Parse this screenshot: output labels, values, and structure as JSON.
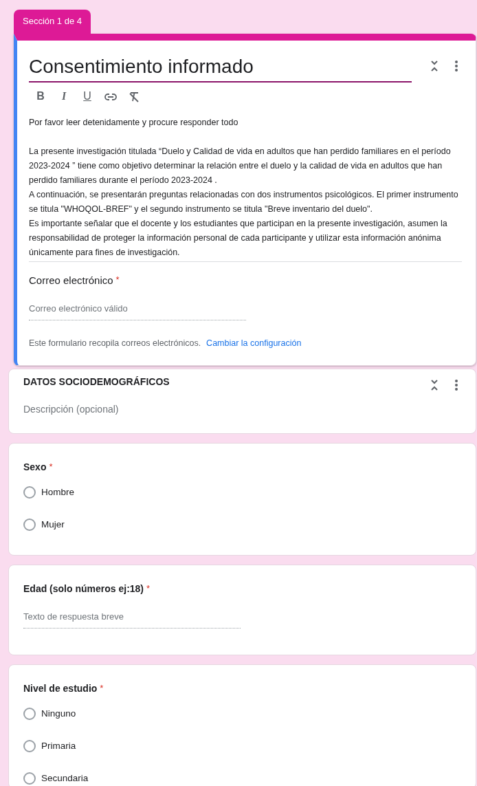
{
  "section_tab": "Sección 1 de 4",
  "header": {
    "title": "Consentimiento informado",
    "format_buttons": [
      {
        "kind": "bold",
        "label": "B"
      },
      {
        "kind": "italic",
        "label": "I"
      },
      {
        "kind": "underline",
        "label": "U"
      },
      {
        "kind": "link"
      },
      {
        "kind": "clear"
      }
    ],
    "description_intro": "Por favor leer detenidamente y procure responder todo",
    "description": [
      "La presente investigación titulada “Duelo y Calidad de vida en adultos que han perdido familiares en el período 2023-2024 ” tiene como objetivo determinar la relación entre el duelo y la calidad de vida en adultos que han perdido familiares durante el período 2023-2024 .",
      "A continuación, se presentarán preguntas relacionadas con dos instrumentos psicológicos. El primer instrumento se titula \"WHOQOL-BREF\" y el segundo instrumento se titula \"Breve inventario del duelo\".",
      "Es importante señalar que el docente y los estudiantes que participan en la presente investigación, asumen la responsabilidad de proteger la información personal de cada participante y utilizar esta información anónima únicamente para fines de investigación."
    ],
    "email": {
      "label": "Correo electrónico",
      "required_mark": "*",
      "placeholder": "Correo electrónico válido"
    },
    "note": "Este formulario recopila correos electrónicos.",
    "note_link": "Cambiar la configuración"
  },
  "section": {
    "title": "DATOS SOCIODEMOGRÁFICOS",
    "description_placeholder": "Descripción (opcional)"
  },
  "questions": [
    {
      "kind": "radio",
      "title": "Sexo",
      "required_mark": "*",
      "options": [
        {
          "label": "Hombre",
          "selected": false
        },
        {
          "label": "Mujer",
          "selected": false
        }
      ]
    },
    {
      "kind": "short",
      "title": "Edad (solo números ej:18)",
      "required_mark": "*",
      "placeholder": "Texto de respuesta breve"
    },
    {
      "kind": "radio",
      "title": "Nivel de estudio",
      "required_mark": "*",
      "options": [
        {
          "label": "Ninguno",
          "selected": false
        },
        {
          "label": "Primaria",
          "selected": false
        },
        {
          "label": "Secundaria",
          "selected": false
        }
      ]
    }
  ]
}
